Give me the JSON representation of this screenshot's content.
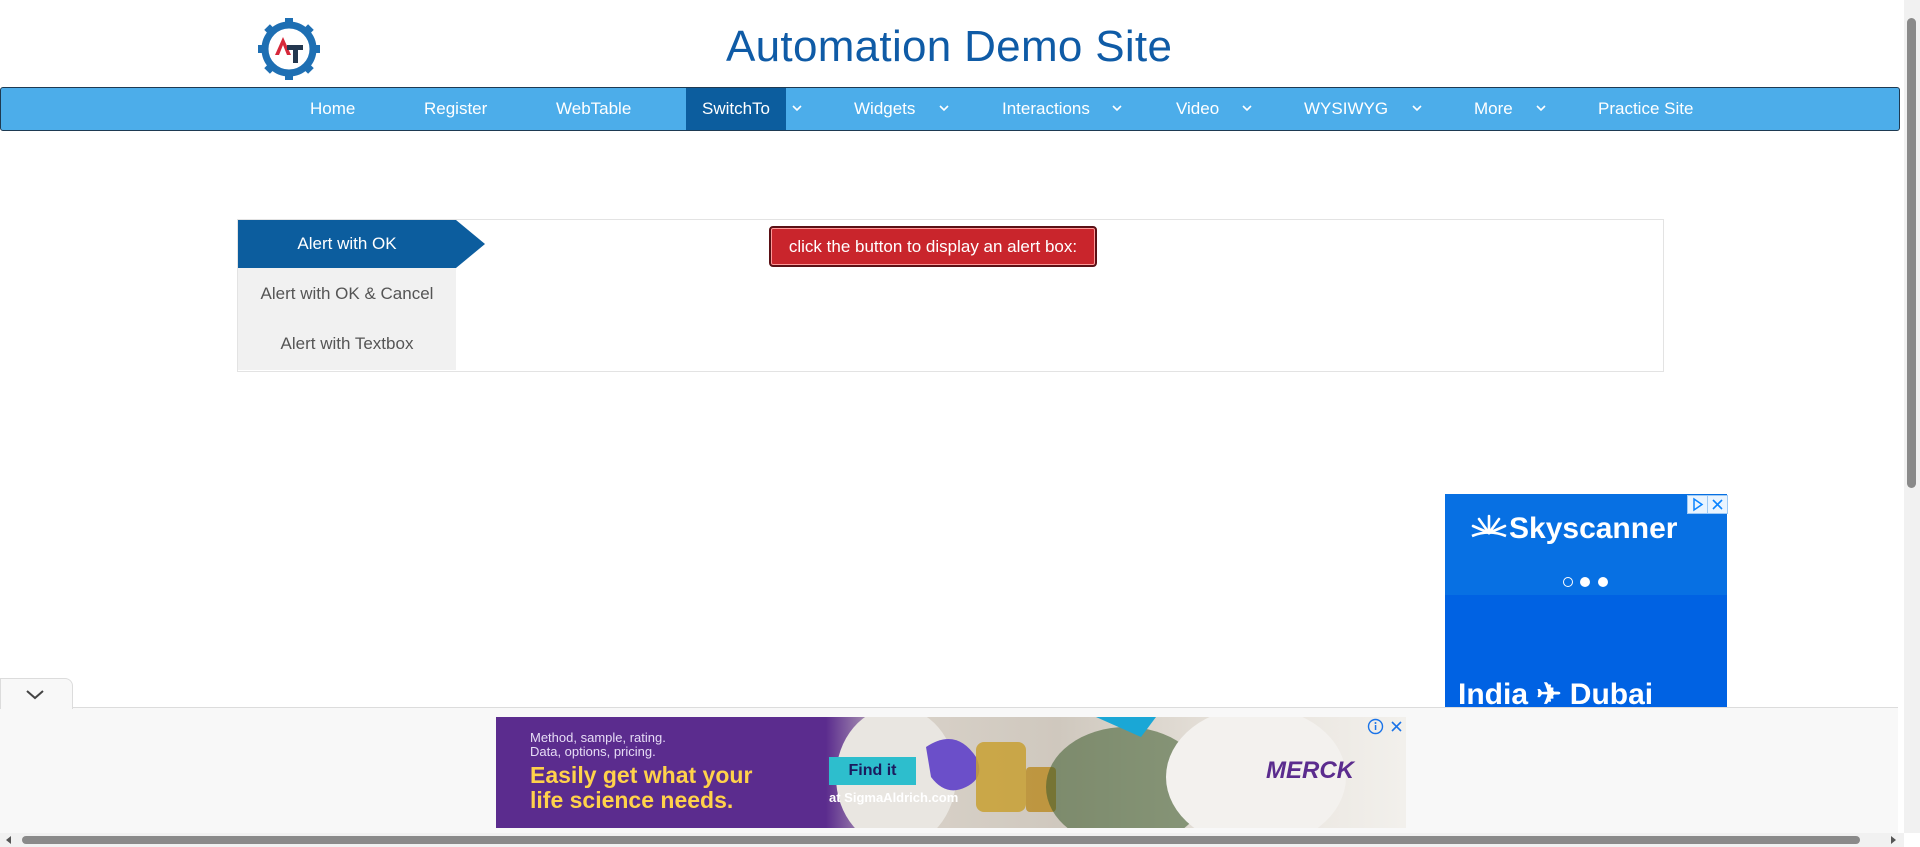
{
  "header": {
    "title": "Automation Demo Site",
    "logo_text": "AT"
  },
  "nav": {
    "items": [
      {
        "label": "Home"
      },
      {
        "label": "Register"
      },
      {
        "label": "WebTable"
      },
      {
        "label": "SwitchTo"
      },
      {
        "label": "Widgets"
      },
      {
        "label": "Interactions"
      },
      {
        "label": "Video"
      },
      {
        "label": "WYSIWYG"
      },
      {
        "label": "More"
      },
      {
        "label": "Practice Site"
      }
    ],
    "active": "SwitchTo"
  },
  "alerts": {
    "tabs": [
      {
        "label": "Alert with OK"
      },
      {
        "label": "Alert with OK & Cancel"
      },
      {
        "label": "Alert with Textbox"
      }
    ],
    "active_tab": "Alert with OK",
    "button_label": "click the button to display an alert box:"
  },
  "side_ad": {
    "brand": "Skyscanner",
    "route": "India ✈ Dubai"
  },
  "bottom_ad": {
    "small_text_1": "Method, sample, rating.",
    "small_text_2": "Data, options, pricing.",
    "headline_1": "Easily get what your",
    "headline_2": "life science needs.",
    "cta": "Find it",
    "cta_sub": "at SigmaAldrich.com",
    "brand": "MERCK"
  },
  "colors": {
    "nav_bg": "#4cadea",
    "nav_active": "#0c5d9e",
    "title": "#0f5ba6",
    "alert_button": "#c9252c"
  }
}
